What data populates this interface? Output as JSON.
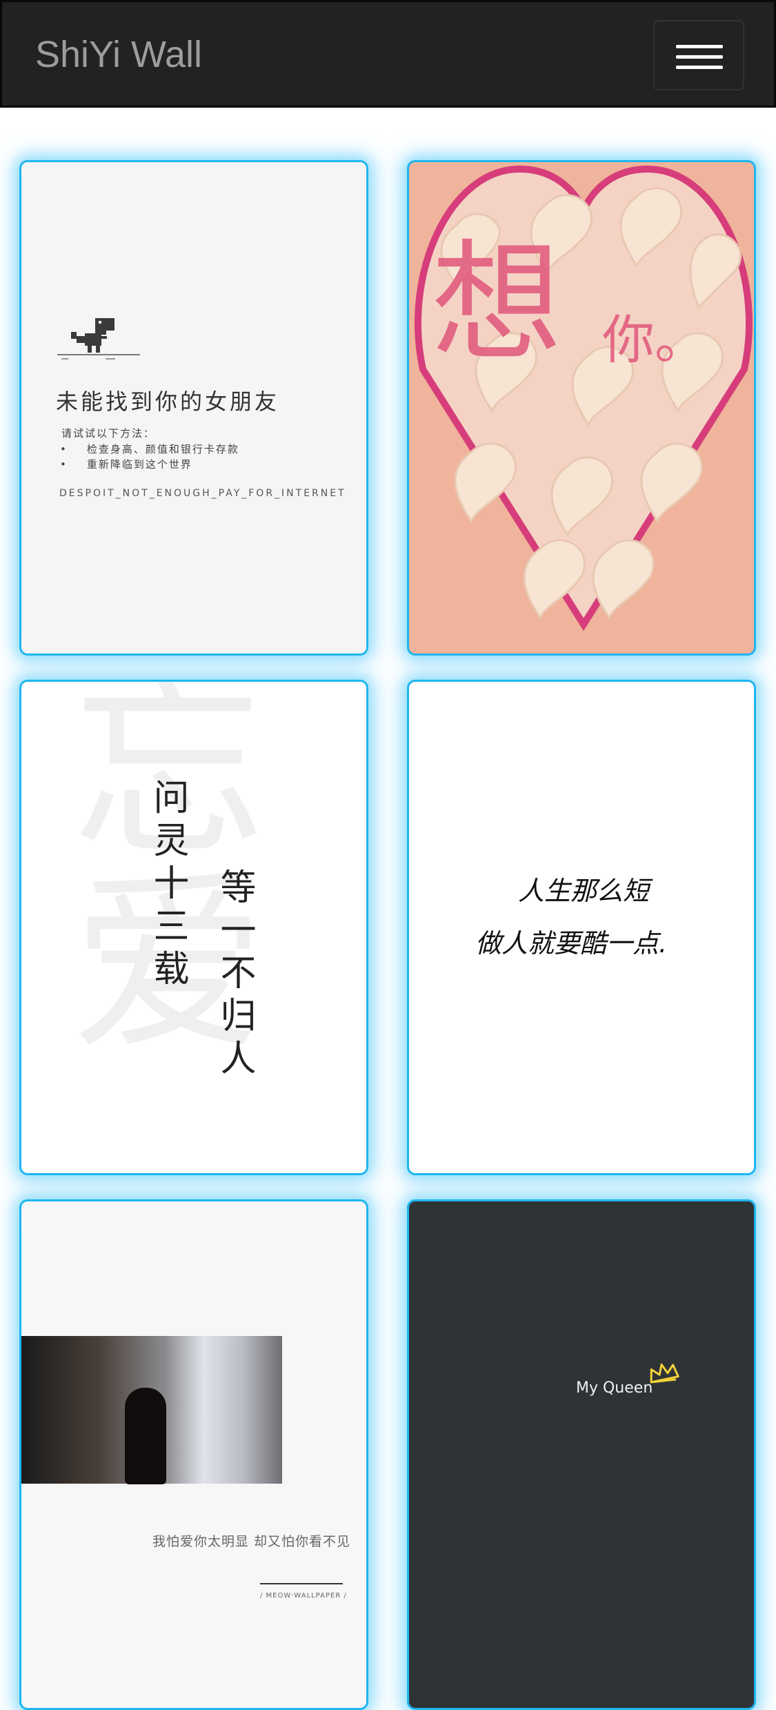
{
  "navbar": {
    "brand": "ShiYi Wall",
    "toggle_label": "Toggle navigation"
  },
  "cards": [
    {
      "title": "未能找到你的女朋友",
      "subtitle": "请试试以下方法：",
      "tips": [
        "检查身高、颜值和银行卡存款",
        "重新降临到这个世界"
      ],
      "code": "DESPOIT_NOT_ENOUGH_PAY_FOR_INTERNET"
    },
    {
      "big": "想",
      "small": "你。"
    },
    {
      "bg_text": "忘爱",
      "line1": "问灵十三载",
      "line2": "等一不归人"
    },
    {
      "line1": "人生那么短",
      "line2": "做人就要酷一点."
    },
    {
      "text": "我怕爱你太明显  却又怕你看不见",
      "signature": "/ MEOW·WALLPAPER /"
    },
    {
      "text": "My Queen"
    }
  ],
  "colors": {
    "navbar_bg": "#222222",
    "brand": "#9d9d9d",
    "card_border": "#1fb6ef",
    "card_glow": "#3dc4fa"
  }
}
